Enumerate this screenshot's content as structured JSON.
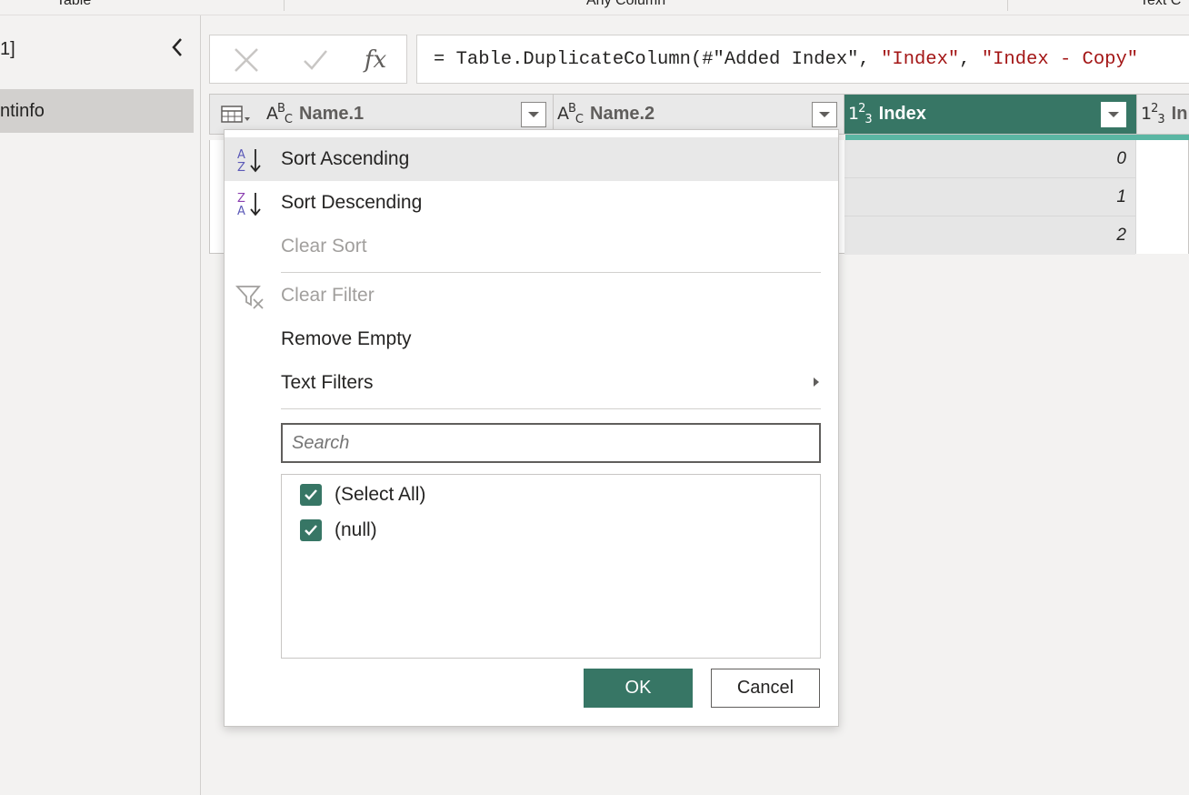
{
  "ribbon": {
    "groups": [
      "Table",
      "Any Column",
      "Text C"
    ]
  },
  "queries": {
    "count": "1]",
    "items": [
      {
        "label": "ntinfo"
      }
    ]
  },
  "formula_bar": {
    "cancel_icon": "close-icon",
    "commit_icon": "checkmark-icon",
    "fx_label": "fx",
    "formula_prefix": "= Table.DuplicateColumn(#\"Added Index\", ",
    "formula_str1": "\"Index\"",
    "formula_sep": ", ",
    "formula_str2": "\"Index - Copy\""
  },
  "grid": {
    "columns": [
      {
        "name": "Name.1",
        "type": "text"
      },
      {
        "name": "Name.2",
        "type": "text"
      },
      {
        "name": "Index",
        "type": "number",
        "active": true
      },
      {
        "name": "In",
        "type": "number"
      }
    ],
    "type_text_label": {
      "a": "A",
      "b": "B",
      "c": "C"
    },
    "type_num_label": {
      "a": "1",
      "b": "2",
      "c": "3"
    },
    "index_values": [
      "0",
      "1",
      "2"
    ],
    "active_color": "#377665",
    "active_bar_color": "#5ab6a3"
  },
  "filter_menu": {
    "items": [
      {
        "label": "Sort Ascending",
        "icon": "sort-ascending-icon",
        "state": "hover"
      },
      {
        "label": "Sort Descending",
        "icon": "sort-descending-icon",
        "state": "normal"
      },
      {
        "label": "Clear Sort",
        "icon": "",
        "state": "disabled"
      },
      {
        "label": "Clear Filter",
        "icon": "clear-filter-icon",
        "state": "disabled"
      },
      {
        "label": "Remove Empty",
        "icon": "",
        "state": "normal"
      },
      {
        "label": "Text Filters",
        "icon": "",
        "state": "normal",
        "submenu": true
      }
    ],
    "search_placeholder": "Search",
    "values": [
      {
        "label": "(Select All)",
        "checked": true
      },
      {
        "label": "(null)",
        "checked": true
      }
    ],
    "ok_label": "OK",
    "cancel_label": "Cancel"
  }
}
